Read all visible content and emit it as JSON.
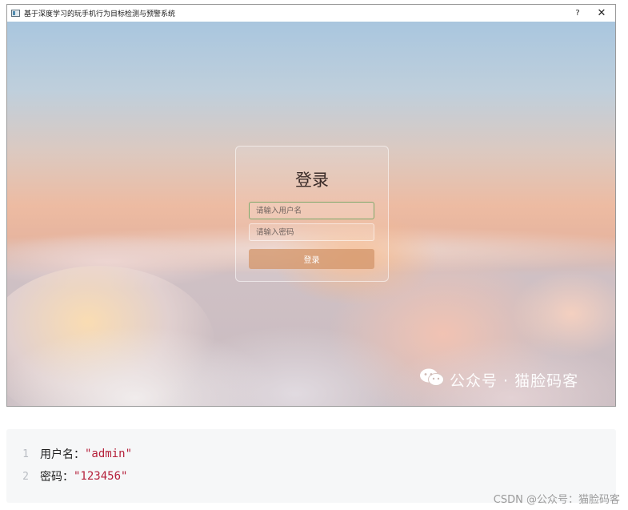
{
  "window": {
    "title": "基于深度学习的玩手机行为目标检测与预警系统",
    "help_label": "?",
    "close_label": "✕"
  },
  "login": {
    "title": "登录",
    "username_placeholder": "请输入用户名",
    "password_placeholder": "请输入密码",
    "submit_label": "登录"
  },
  "watermark": {
    "label": "公众号 · 猫脸码客",
    "icon": "wechat-icon"
  },
  "code": {
    "lines": [
      {
        "number": "1",
        "key": "用户名：",
        "value": "\"admin\""
      },
      {
        "number": "2",
        "key": "密码：",
        "value": "\"123456\""
      }
    ]
  },
  "footer": {
    "csdn_watermark": "CSDN @公众号：猫脸码客"
  },
  "colors": {
    "button_accent": "#d3976d",
    "username_border": "#7ea86a",
    "code_string": "#b5213b"
  }
}
